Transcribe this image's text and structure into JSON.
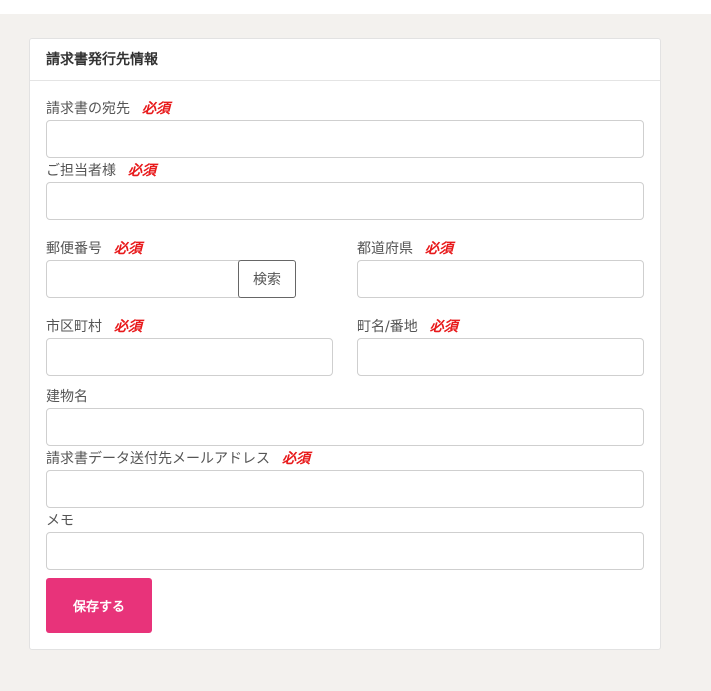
{
  "card": {
    "title": "請求書発行先情報"
  },
  "required_label": "必須",
  "fields": {
    "recipient": {
      "label": "請求書の宛先",
      "value": ""
    },
    "contact_person": {
      "label": "ご担当者様",
      "value": ""
    },
    "postal_code": {
      "label": "郵便番号",
      "value": ""
    },
    "prefecture": {
      "label": "都道府県",
      "value": ""
    },
    "city": {
      "label": "市区町村",
      "value": ""
    },
    "town_address": {
      "label": "町名/番地",
      "value": ""
    },
    "building": {
      "label": "建物名",
      "value": ""
    },
    "invoice_email": {
      "label": "請求書データ送付先メールアドレス",
      "value": ""
    },
    "memo": {
      "label": "メモ",
      "value": ""
    }
  },
  "buttons": {
    "search": "検索",
    "save": "保存する"
  },
  "colors": {
    "page_background": "#f3f1ee",
    "required": "#e8191b",
    "save_button": "#e8337a"
  }
}
